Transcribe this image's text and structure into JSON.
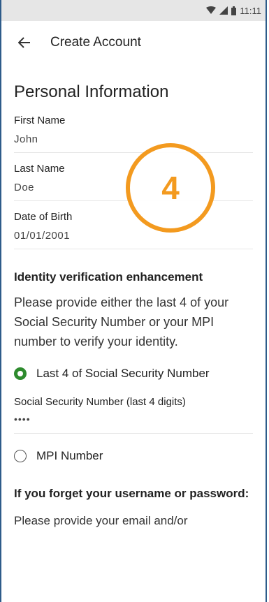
{
  "status_bar": {
    "time": "11:11"
  },
  "app_bar": {
    "title": "Create Account"
  },
  "section": {
    "title": "Personal Information"
  },
  "fields": [
    {
      "label": "First Name",
      "value": "John"
    },
    {
      "label": "Last Name",
      "value": "Doe"
    },
    {
      "label": "Date of Birth",
      "value": "01/01/2001"
    }
  ],
  "verification": {
    "heading": "Identity verification enhancement",
    "description": "Please provide either the last 4 of your Social Security Number or your MPI number to verify your identity.",
    "options": [
      {
        "label": "Last 4 of Social Security Number",
        "selected": true
      },
      {
        "label": "MPI Number",
        "selected": false
      }
    ],
    "ssn_label": "Social Security Number (last 4 digits)",
    "ssn_value": "••••"
  },
  "forget": {
    "heading": "If you forget your username or password:",
    "text": "Please provide your email and/or"
  },
  "step_badge": {
    "number": "4",
    "color": "#f39a1f"
  },
  "colors": {
    "radio_selected": "#2e8b2e",
    "frame_border": "#2e5c8a"
  }
}
